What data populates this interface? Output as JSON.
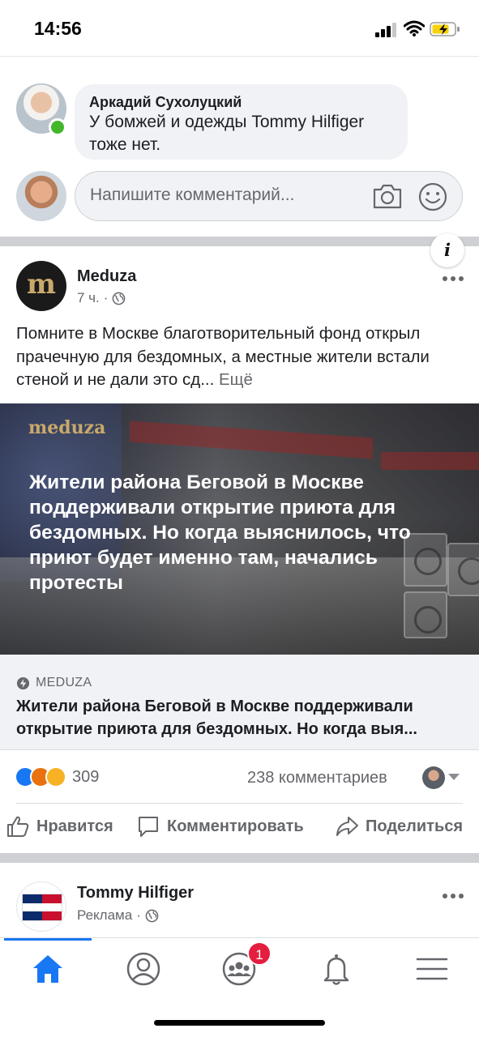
{
  "status_bar": {
    "time": "14:56"
  },
  "comment": {
    "author": "Аркадий Сухолуцкий",
    "text": "У бомжей и одежды Tommy Hilfiger тоже нет."
  },
  "comment_input": {
    "placeholder": "Напишите комментарий..."
  },
  "post": {
    "page_name": "Meduza",
    "logo_letter": "m",
    "time": "7 ч.",
    "separator": "·",
    "text": "Помните в Москве благотворительный фонд открыл прачечную для бездомных, а местные жители встали стеной и не дали это сд...",
    "see_more": "Ещё",
    "hero_brand": "meduza",
    "hero_title": "Жители района Беговой в Москве поддерживали открытие приюта для бездомных. Но когда выяснилось, что приют будет именно там, начались протесты",
    "info_label": "i",
    "link_source": "MEDUZA",
    "link_title": "Жители района Беговой в Москве поддерживали открытие приюта для бездомных. Но когда выя...",
    "reaction_count": "309",
    "comments_count": "238 комментариев",
    "actions": {
      "like": "Нравится",
      "comment": "Комментировать",
      "share": "Поделиться"
    }
  },
  "ad_post": {
    "page_name": "Tommy Hilfiger",
    "label": "Реклама",
    "separator": "·"
  },
  "tab_bar": {
    "groups_badge": "1"
  },
  "colors": {
    "accent": "#1877f2",
    "online": "#42b72a",
    "badge": "#e41e3f",
    "meduza_gold": "#c9a96b"
  },
  "icons": [
    "signal-icon",
    "wifi-icon",
    "battery-charging-icon",
    "camera-icon",
    "smile-icon",
    "globe-icon",
    "more-icon",
    "info-icon",
    "bolt-icon",
    "like-icon",
    "comment-icon",
    "share-icon",
    "home-icon",
    "profile-icon",
    "groups-icon",
    "bell-icon",
    "menu-icon"
  ]
}
